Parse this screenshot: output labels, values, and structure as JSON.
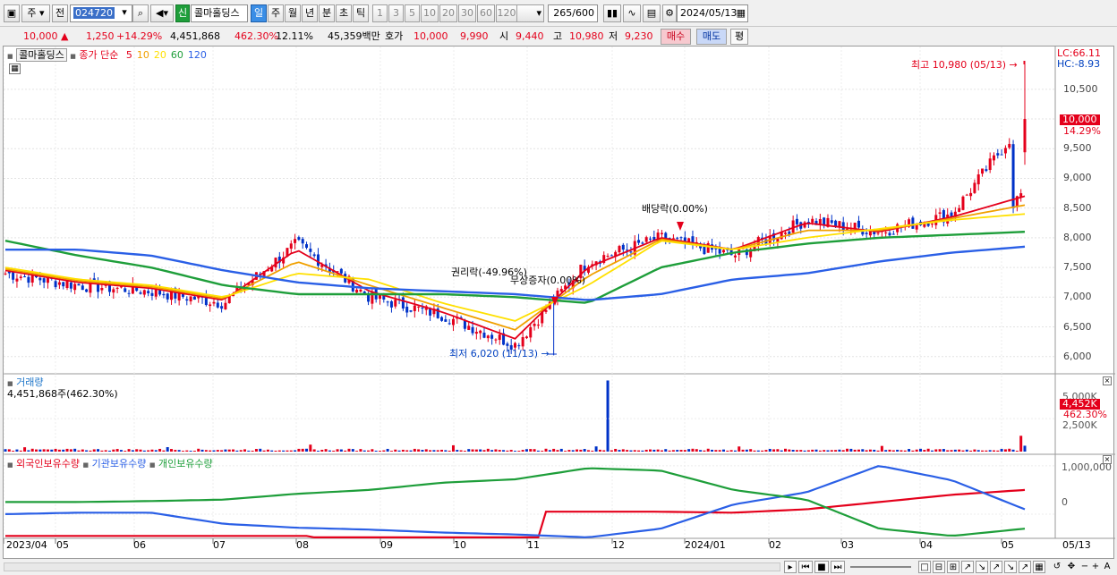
{
  "toolbar": {
    "type_select": "주",
    "prev_label": "전",
    "code_value": "024720",
    "market_badge": "신",
    "stock_name": "콜마홀딩스",
    "period_tabs": [
      "일",
      "주",
      "월",
      "년",
      "분",
      "초",
      "틱"
    ],
    "active_period": "일",
    "minute_options": [
      "1",
      "3",
      "5",
      "10",
      "20",
      "30",
      "60",
      "120"
    ],
    "count_value": "265",
    "count_total": "/600",
    "date_value": "2024/05/13"
  },
  "quote": {
    "price": "10,000",
    "change": "1,250",
    "change_pct": "+14.29%",
    "volume": "4,451,868",
    "volume_ratio": "462.30%",
    "turnover": "12.11%",
    "amount": "45,359백만",
    "ask_label": "호가",
    "ask_price": "10,000",
    "bid_price": "9,990",
    "open_label": "시",
    "open": "9,440",
    "high_label": "고",
    "high": "10,980",
    "low_label": "저",
    "low": "9,230",
    "buy_label": "매수",
    "sell_label": "매도",
    "eval_label": "평"
  },
  "price_panel": {
    "title": "콜마홀딩스",
    "ma_title": "종가 단순",
    "ma_periods": [
      "5",
      "10",
      "20",
      "60",
      "120"
    ],
    "ma_colors": [
      "#e4001b",
      "#f0a000",
      "#ffe000",
      "#1e9e3a",
      "#2a5fe6"
    ],
    "lc_label": "LC:66.11",
    "hc_label": "HC:-8.93",
    "y_ticks": [
      "10,500",
      "10,000",
      "9,500",
      "9,000",
      "8,500",
      "8,000",
      "7,500",
      "7,000",
      "6,500",
      "6,000"
    ],
    "current_price_label": "10,000",
    "current_pct_label": "14.29%",
    "annotations": {
      "high": "최고 10,980 (05/13)",
      "low": "최저 6,020 (11/13)",
      "rights": "권리락(-49.96%)",
      "capital_increase": "무상증자(0.00%)",
      "dividend": "배당락(0.00%)"
    }
  },
  "volume_panel": {
    "title": "거래량",
    "value_label": "4,451,868주(462.30%)",
    "y_ticks": [
      "5,000K",
      "2,500K"
    ],
    "current_label": "4,452K",
    "current_pct": "462.30%"
  },
  "holdings_panel": {
    "legend": [
      "외국인보유수량",
      "기관보유수량",
      "개인보유수량"
    ],
    "legend_colors": [
      "#e4001b",
      "#2a5fe6",
      "#1e9e3a"
    ],
    "y_ticks": [
      "1,000,000",
      "0"
    ]
  },
  "x_axis": [
    "2023/04",
    "05",
    "06",
    "07",
    "08",
    "09",
    "10",
    "11",
    "12",
    "2024/01",
    "02",
    "03",
    "04",
    "05",
    "05/13"
  ],
  "chart_data": [
    {
      "type": "candlestick",
      "title": "콜마홀딩스",
      "x": [
        "2023/04",
        "05",
        "06",
        "07",
        "08",
        "09",
        "10",
        "11",
        "12",
        "2024/01",
        "02",
        "03",
        "04",
        "05",
        "05/13"
      ],
      "ylim": [
        5800,
        11100
      ],
      "close_approx": [
        7400,
        7200,
        7100,
        6900,
        7900,
        7000,
        6700,
        6200,
        7600,
        8000,
        7700,
        8300,
        8100,
        8400,
        10000
      ],
      "ma5_approx": [
        7450,
        7250,
        7150,
        6950,
        7800,
        7100,
        6750,
        6300,
        7500,
        8000,
        7800,
        8250,
        8100,
        8350,
        8700
      ],
      "ma20_approx": [
        7500,
        7300,
        7200,
        7000,
        7400,
        7300,
        6900,
        6600,
        7200,
        7950,
        7800,
        8000,
        8150,
        8300,
        8400
      ],
      "ma60_approx": [
        7950,
        7700,
        7500,
        7200,
        7050,
        7050,
        7050,
        7000,
        6900,
        7500,
        7750,
        7900,
        8000,
        8050,
        8100
      ],
      "ma120_approx": [
        7800,
        7800,
        7700,
        7450,
        7250,
        7150,
        7100,
        7050,
        6950,
        7050,
        7300,
        7400,
        7600,
        7750,
        7850
      ],
      "high": 10980,
      "low": 6020,
      "last": 10000
    },
    {
      "type": "bar",
      "title": "거래량",
      "note": "volume spikes",
      "ylim": [
        0,
        5500000
      ],
      "spikes": [
        {
          "x": "2023/12",
          "value": 5400000
        },
        {
          "x": "05/13",
          "value": 4451868
        }
      ]
    },
    {
      "type": "line",
      "title": "보유수량",
      "ylim": [
        -500000,
        1200000
      ],
      "series": [
        {
          "name": "외국인보유수량",
          "values": [
            -450000,
            -450000,
            -450000,
            -450000,
            -450000,
            -450000,
            -450000,
            50000,
            50000,
            50000,
            30000,
            100000,
            250000,
            400000,
            500000
          ]
        },
        {
          "name": "기관보유수량",
          "values": [
            0,
            30000,
            30000,
            -200000,
            -280000,
            -320000,
            -380000,
            -420000,
            -480000,
            -300000,
            200000,
            450000,
            1000000,
            700000,
            100000
          ]
        },
        {
          "name": "개인보유수량",
          "values": [
            250000,
            250000,
            270000,
            300000,
            420000,
            500000,
            650000,
            720000,
            950000,
            900000,
            500000,
            300000,
            -300000,
            -450000,
            -300000
          ]
        }
      ]
    }
  ]
}
